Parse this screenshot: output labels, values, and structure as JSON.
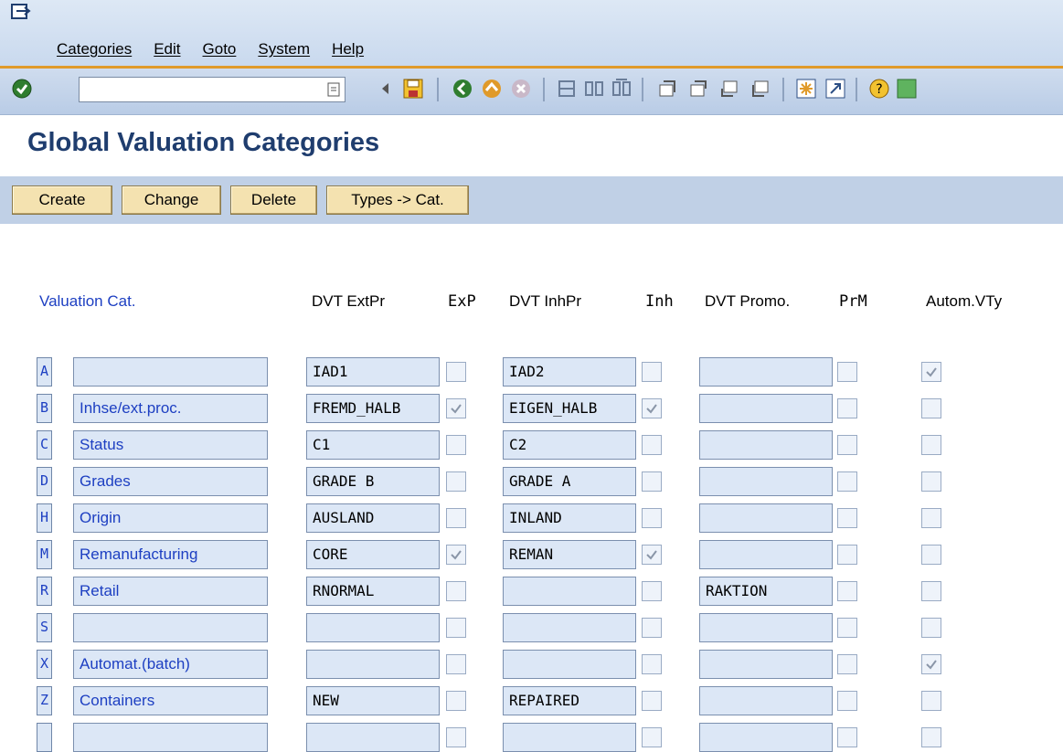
{
  "menu": {
    "items": [
      "Categories",
      "Edit",
      "Goto",
      "System",
      "Help"
    ]
  },
  "toolbar": {
    "command_value": ""
  },
  "page": {
    "title": "Global Valuation Categories"
  },
  "app_toolbar": {
    "create": "Create",
    "change": "Change",
    "delete": "Delete",
    "types_to_cat": "Types -> Cat."
  },
  "table": {
    "headers": {
      "valuation_cat": "Valuation Cat.",
      "dvt_extpr": "DVT ExtPr",
      "exp": "ExP",
      "dvt_inhpr": "DVT InhPr",
      "inh": "Inh",
      "dvt_promo": "DVT Promo.",
      "prm": "PrM",
      "autom_vty": "Autom.VTy"
    },
    "rows": [
      {
        "key": "A",
        "desc": "",
        "ext": "IAD1",
        "exp": false,
        "inh_val": "IAD2",
        "inh": false,
        "promo": "",
        "prm": false,
        "autom": true
      },
      {
        "key": "B",
        "desc": "Inhse/ext.proc.",
        "ext": "FREMD_HALB",
        "exp": true,
        "inh_val": "EIGEN_HALB",
        "inh": true,
        "promo": "",
        "prm": false,
        "autom": false
      },
      {
        "key": "C",
        "desc": "Status",
        "ext": "C1",
        "exp": false,
        "inh_val": "C2",
        "inh": false,
        "promo": "",
        "prm": false,
        "autom": false
      },
      {
        "key": "D",
        "desc": "Grades",
        "ext": "GRADE B",
        "exp": false,
        "inh_val": "GRADE A",
        "inh": false,
        "promo": "",
        "prm": false,
        "autom": false
      },
      {
        "key": "H",
        "desc": "Origin",
        "ext": "AUSLAND",
        "exp": false,
        "inh_val": "INLAND",
        "inh": false,
        "promo": "",
        "prm": false,
        "autom": false
      },
      {
        "key": "M",
        "desc": "Remanufacturing",
        "ext": "CORE",
        "exp": true,
        "inh_val": "REMAN",
        "inh": true,
        "promo": "",
        "prm": false,
        "autom": false
      },
      {
        "key": "R",
        "desc": "Retail",
        "ext": "RNORMAL",
        "exp": false,
        "inh_val": "",
        "inh": false,
        "promo": "RAKTION",
        "prm": false,
        "autom": false
      },
      {
        "key": "S",
        "desc": "",
        "ext": "",
        "exp": false,
        "inh_val": "",
        "inh": false,
        "promo": "",
        "prm": false,
        "autom": false
      },
      {
        "key": "X",
        "desc": "Automat.(batch)",
        "ext": "",
        "exp": false,
        "inh_val": "",
        "inh": false,
        "promo": "",
        "prm": false,
        "autom": true
      },
      {
        "key": "Z",
        "desc": "Containers",
        "ext": "NEW",
        "exp": false,
        "inh_val": "REPAIRED",
        "inh": false,
        "promo": "",
        "prm": false,
        "autom": false
      },
      {
        "key": "",
        "desc": "",
        "ext": "",
        "exp": false,
        "inh_val": "",
        "inh": false,
        "promo": "",
        "prm": false,
        "autom": false
      }
    ]
  },
  "colors": {
    "menubar": "#dde8f5",
    "accent_line": "#e09a2a",
    "title": "#1f3d6e",
    "link_blue": "#1d3fc2",
    "button_bg": "#f4e2b0",
    "field_bg": "#dce7f6"
  }
}
